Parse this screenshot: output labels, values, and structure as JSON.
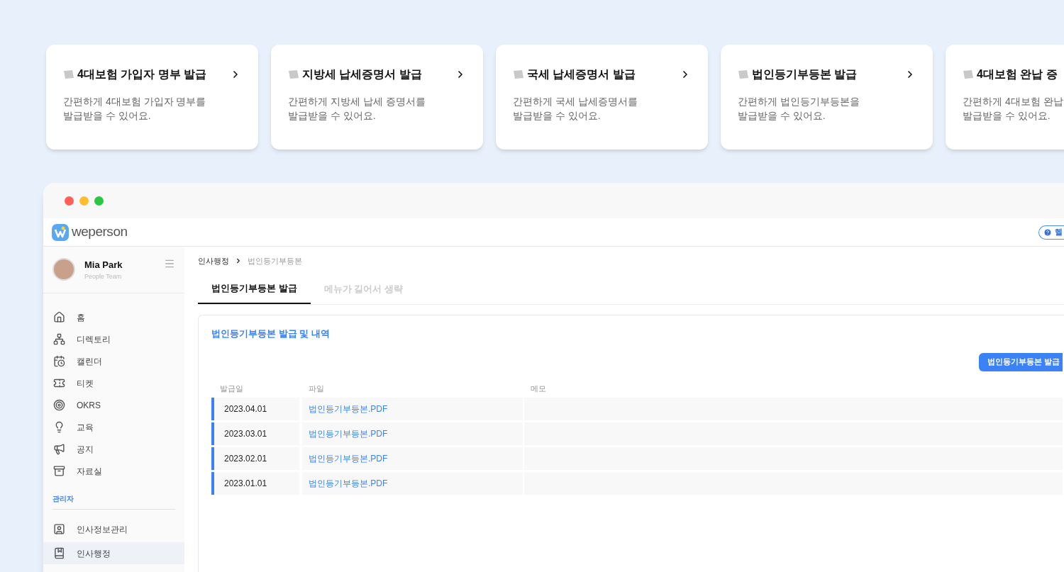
{
  "cards": [
    {
      "title": "4대보험 가입자 명부 발급",
      "lines": [
        "간편하게 4대보험 가입자 명부를",
        "발급받을 수 있어요."
      ]
    },
    {
      "title": "지방세 납세증명서 발급",
      "lines": [
        "간편하게 지방세 납세 증명서를",
        "발급받을 수 있어요."
      ]
    },
    {
      "title": "국세 납세증명서 발급",
      "lines": [
        "간편하게 국세 납세증명서를",
        "발급받을 수 있어요."
      ]
    },
    {
      "title": "법인등기부등본 발급",
      "lines": [
        "간편하게 법인등기부등본을",
        "발급받을 수 있어요."
      ]
    },
    {
      "title": "4대보험 완납 증",
      "lines": [
        "간편하게 4대보험 완납",
        "발급받을 수 있어요."
      ]
    }
  ],
  "app": {
    "logo": "weperson",
    "help": "헬",
    "user": {
      "name": "Mia Park",
      "team": "People Team"
    },
    "nav": [
      {
        "label": "홈",
        "selected": false
      },
      {
        "label": "디렉토리",
        "selected": false
      },
      {
        "label": "캘린더",
        "selected": false
      },
      {
        "label": "티켓",
        "selected": false
      },
      {
        "label": "OKRS",
        "selected": false
      },
      {
        "label": "교육",
        "selected": false
      },
      {
        "label": "공지",
        "selected": false
      },
      {
        "label": "자료실",
        "selected": false
      }
    ],
    "admin_heading": "관리자",
    "admin_nav": [
      {
        "label": "인사정보관리",
        "selected": false
      },
      {
        "label": "인사행정",
        "selected": true
      }
    ],
    "breadcrumb": [
      "인사행정",
      "법인등기부등본"
    ],
    "tabs": [
      {
        "label": "법인등기부등본 발급",
        "selected": true
      },
      {
        "label": "메뉴가 길어서 생략",
        "selected": false
      }
    ],
    "panel": {
      "title": "법인등기부등본 발급 및 내역",
      "button": "법인등기부등본 발급",
      "columns": [
        "발급일",
        "파일",
        "메모"
      ],
      "rows": [
        {
          "date": "2023.04.01",
          "file": "법인등기부등본.PDF"
        },
        {
          "date": "2023.03.01",
          "file": "법인등기부등본.PDF"
        },
        {
          "date": "2023.02.01",
          "file": "법인등기부등본.PDF"
        },
        {
          "date": "2023.01.01",
          "file": "법인등기부등본.PDF"
        }
      ]
    }
  }
}
